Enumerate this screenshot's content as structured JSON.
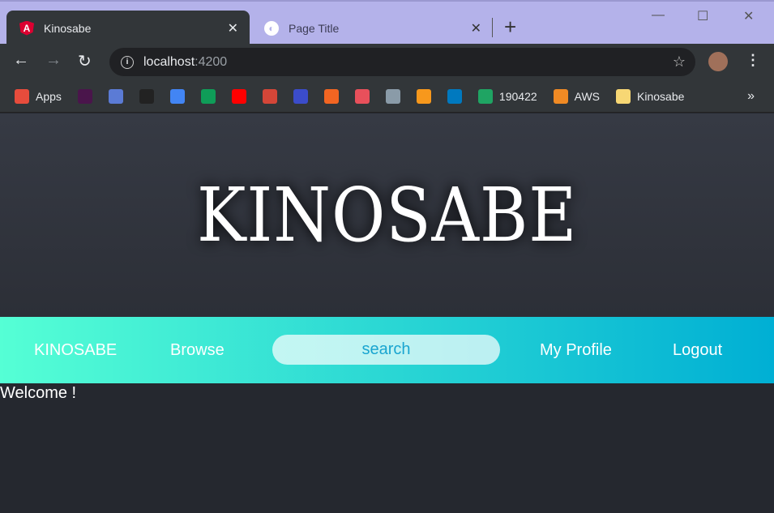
{
  "browser": {
    "tabs": [
      {
        "title": "Kinosabe",
        "icon": "angular-icon",
        "active": true
      },
      {
        "title": "Page Title",
        "icon": "globe-icon",
        "active": false
      }
    ],
    "url_host": "localhost",
    "url_port": ":4200",
    "bookmarks": [
      {
        "label": "Apps",
        "color": "#e74c3c"
      },
      {
        "label": "",
        "color": "#4a154b"
      },
      {
        "label": "",
        "color": "#5b7bd5"
      },
      {
        "label": "",
        "color": "#222"
      },
      {
        "label": "",
        "color": "#4285f4"
      },
      {
        "label": "",
        "color": "#0f9d58"
      },
      {
        "label": "",
        "color": "#ff0000"
      },
      {
        "label": "",
        "color": "#d44638"
      },
      {
        "label": "",
        "color": "#3b4cca"
      },
      {
        "label": "",
        "color": "#f26522"
      },
      {
        "label": "",
        "color": "#e8505b"
      },
      {
        "label": "",
        "color": "#8a9ba8"
      },
      {
        "label": "",
        "color": "#f7981c"
      },
      {
        "label": "",
        "color": "#0079bf"
      },
      {
        "label": "190422",
        "color": "#1fa463"
      },
      {
        "label": "AWS",
        "color": "#f08a24"
      },
      {
        "label": "Kinosabe",
        "color": "#f7d774"
      }
    ],
    "more": "»"
  },
  "hero": {
    "title": "KINOSABE"
  },
  "nav": {
    "brand": "KINOSABE",
    "browse": "Browse",
    "search_placeholder": "search",
    "profile": "My Profile",
    "logout": "Logout"
  },
  "main": {
    "welcome": "Welcome !"
  }
}
